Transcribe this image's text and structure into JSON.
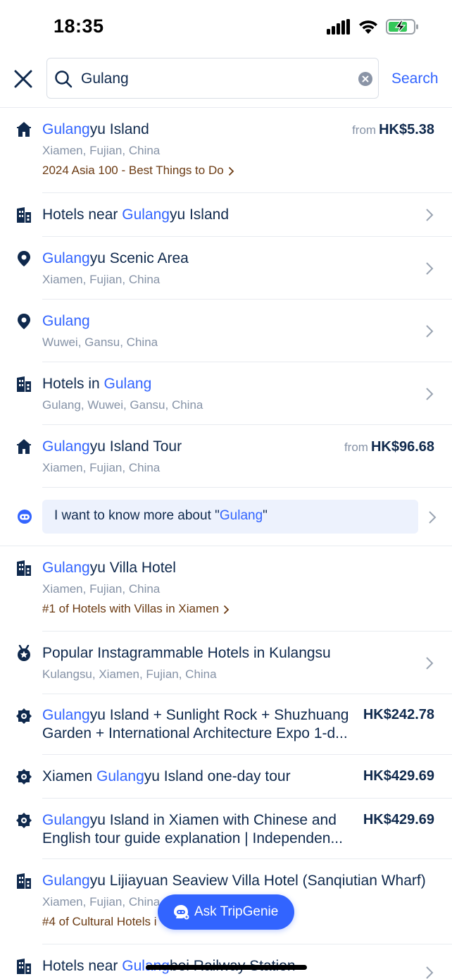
{
  "status_bar": {
    "time": "18:35"
  },
  "search": {
    "value": "Gulang",
    "button_label": "Search"
  },
  "results": [
    {
      "icon": "attraction-icon",
      "hl": "Gulang",
      "rest": "yu Island",
      "sub": "Xiamen, Fujian, China",
      "rank": "2024 Asia 100 - Best Things to Do",
      "price_prefix": "from",
      "price": "HK$5.38"
    },
    {
      "icon": "hotel-icon",
      "pre": "Hotels near ",
      "hl": "Gulang",
      "rest": "yu Island"
    },
    {
      "icon": "location-pin-icon",
      "hl": "Gulang",
      "rest": "yu Scenic Area",
      "sub": "Xiamen, Fujian, China"
    },
    {
      "icon": "location-pin-icon",
      "hl": "Gulang",
      "rest": "",
      "sub": "Wuwei, Gansu, China"
    },
    {
      "icon": "hotel-icon",
      "pre": "Hotels in ",
      "hl": "Gulang",
      "rest": "",
      "sub": "Gulang, Wuwei, Gansu, China"
    },
    {
      "icon": "attraction-icon",
      "hl": "Gulang",
      "rest": "yu Island Tour",
      "sub": "Xiamen, Fujian, China",
      "price_prefix": "from",
      "price": "HK$96.68"
    },
    {
      "ai_pre": "I want to know more about \"",
      "ai_hl": "Gulang",
      "ai_post": "\""
    },
    {
      "icon": "hotel-icon",
      "hl": "Gulang",
      "rest": "yu Villa Hotel",
      "sub": "Xiamen, Fujian, China",
      "rank": "#1 of Hotels with Villas in Xiamen"
    },
    {
      "icon": "badge-icon",
      "pre": "Popular Instagrammable Hotels in Kulangsu",
      "sub": "Kulangsu, Xiamen, Fujian, China"
    },
    {
      "icon": "tour-icon",
      "hl": "Gulang",
      "rest": "yu Island + Sunlight Rock + Shuzhuang",
      "line2": "Garden + International Architecture Expo 1-d...",
      "price": "HK$242.78"
    },
    {
      "icon": "tour-icon",
      "pre": "Xiamen ",
      "hl": "Gulang",
      "rest": "yu Island one-day tour",
      "price": "HK$429.69"
    },
    {
      "icon": "tour-icon",
      "hl": "Gulang",
      "rest": "yu Island in Xiamen with Chinese and",
      "line2": "English tour guide explanation | Independen...",
      "price": "HK$429.69"
    },
    {
      "icon": "hotel-icon",
      "hl": "Gulang",
      "rest": "yu Lijiayuan Seaview Villa Hotel (Sanqiutian Wharf)",
      "sub": "Xiamen, Fujian, China",
      "rank": "#4 of Cultural Hotels i"
    },
    {
      "icon": "hotel-icon",
      "pre": "Hotels near ",
      "hl": "Gulang",
      "rest": "bei Railway Station"
    }
  ],
  "fab": {
    "label": "Ask TripGenie"
  },
  "colors": {
    "accent": "#3264ff",
    "text": "#0f294d",
    "muted": "#8592a6",
    "rank": "#6b3a12",
    "ai_bg": "#edf2fd"
  }
}
